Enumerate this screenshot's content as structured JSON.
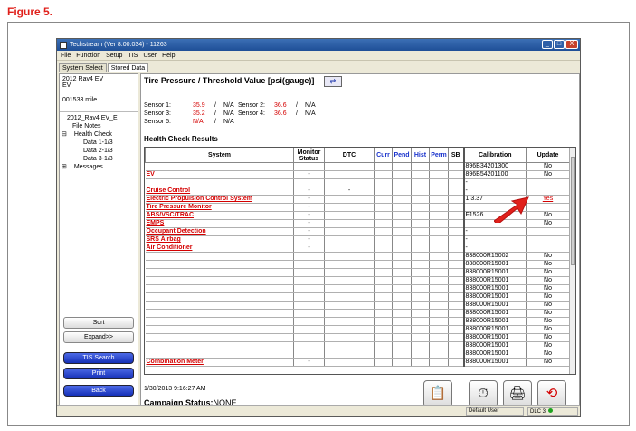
{
  "figure_label": "Figure 5.",
  "window": {
    "title": "Techstream (Ver 8.00.034) - 11263",
    "controls": [
      "_",
      "□",
      "X"
    ]
  },
  "menu": [
    "File",
    "Function",
    "Setup",
    "TIS",
    "User",
    "Help"
  ],
  "tabs": [
    "System Select",
    "Stored Data"
  ],
  "left_panel": {
    "vehicle": "2012 Rav4 EV",
    "vehicle_sub": "EV",
    "mileage": "001533 mile",
    "tree": [
      {
        "label": "2012_Rav4 EV_E",
        "prefix": ""
      },
      {
        "label": "File Notes",
        "prefix": ""
      },
      {
        "label": "Health Check",
        "prefix": "⊟"
      },
      {
        "label": "Data 1-1/3",
        "prefix": ""
      },
      {
        "label": "Data 2-1/3",
        "prefix": ""
      },
      {
        "label": "Data 3-1/3",
        "prefix": ""
      },
      {
        "label": "Messages",
        "prefix": "⊞"
      }
    ],
    "sort_label": "Sort",
    "expand_label": "Expand>>",
    "tis_search_label": "TIS Search",
    "print_label": "Print",
    "back_label": "Back"
  },
  "tire_pressure": {
    "title": "Tire Pressure / Threshold Value [psi(gauge)]",
    "sensors": [
      {
        "label": "Sensor 1:",
        "value": "35.9",
        "threshold": "N/A",
        "label2": "Sensor 2:",
        "value2": "36.6",
        "threshold2": "N/A"
      },
      {
        "label": "Sensor 3:",
        "value": "35.2",
        "threshold": "N/A",
        "label2": "Sensor 4:",
        "value2": "36.6",
        "threshold2": "N/A"
      },
      {
        "label": "Sensor 5:",
        "value": "N/A",
        "threshold": "N/A",
        "label2": "",
        "value2": "",
        "threshold2": ""
      }
    ]
  },
  "health_check": {
    "title": "Health Check Results",
    "columns": [
      "System",
      "Monitor Status",
      "DTC",
      "Curr",
      "Pend",
      "Hist",
      "Perm",
      "SB",
      "Calibration",
      "Update"
    ],
    "rows": [
      {
        "system": "",
        "monitor": "",
        "dtc": "",
        "calibration": "896B34201300",
        "update": "No"
      },
      {
        "system": "EV",
        "monitor": "-",
        "dtc": "",
        "calibration": "896B54201100",
        "update": "No"
      },
      {
        "system": "",
        "monitor": "",
        "dtc": "",
        "calibration": "-",
        "update": ""
      },
      {
        "system": "Cruise Control",
        "monitor": "-",
        "dtc": "-",
        "calibration": "-",
        "update": ""
      },
      {
        "system": "Electric Propulsion Control System",
        "monitor": "-",
        "dtc": "",
        "calibration": "1.3.37",
        "update": "Yes"
      },
      {
        "system": "Tire Pressure Monitor",
        "monitor": "-",
        "dtc": "",
        "calibration": "",
        "update": ""
      },
      {
        "system": "ABS/VSC/TRAC",
        "monitor": "-",
        "dtc": "",
        "calibration": "F1526",
        "update": "No"
      },
      {
        "system": "EMPS",
        "monitor": "-",
        "dtc": "",
        "calibration": "",
        "update": "No"
      },
      {
        "system": "Occupant Detection",
        "monitor": "-",
        "dtc": "",
        "calibration": "-",
        "update": ""
      },
      {
        "system": "SRS Airbag",
        "monitor": "-",
        "dtc": "",
        "calibration": "-",
        "update": ""
      },
      {
        "system": "Air Conditioner",
        "monitor": "-",
        "dtc": "",
        "calibration": "-",
        "update": ""
      },
      {
        "system": "",
        "monitor": "",
        "dtc": "",
        "calibration": "838000R15002",
        "update": "No"
      },
      {
        "system": "",
        "monitor": "",
        "dtc": "",
        "calibration": "838000R15001",
        "update": "No"
      },
      {
        "system": "",
        "monitor": "",
        "dtc": "",
        "calibration": "838000R15001",
        "update": "No"
      },
      {
        "system": "",
        "monitor": "",
        "dtc": "",
        "calibration": "838000R15001",
        "update": "No"
      },
      {
        "system": "",
        "monitor": "",
        "dtc": "",
        "calibration": "838000R15001",
        "update": "No"
      },
      {
        "system": "",
        "monitor": "",
        "dtc": "",
        "calibration": "838000R15001",
        "update": "No"
      },
      {
        "system": "",
        "monitor": "",
        "dtc": "",
        "calibration": "838000R15001",
        "update": "No"
      },
      {
        "system": "",
        "monitor": "",
        "dtc": "",
        "calibration": "838000R15001",
        "update": "No"
      },
      {
        "system": "",
        "monitor": "",
        "dtc": "",
        "calibration": "838000R15001",
        "update": "No"
      },
      {
        "system": "",
        "monitor": "",
        "dtc": "",
        "calibration": "838000R15001",
        "update": "No"
      },
      {
        "system": "",
        "monitor": "",
        "dtc": "",
        "calibration": "838000R15001",
        "update": "No"
      },
      {
        "system": "",
        "monitor": "",
        "dtc": "",
        "calibration": "838000R15001",
        "update": "No"
      },
      {
        "system": "",
        "monitor": "",
        "dtc": "",
        "calibration": "838000R15001",
        "update": "No"
      },
      {
        "system": "Combination Meter",
        "monitor": "-",
        "dtc": "",
        "calibration": "838000R15001",
        "update": "No"
      }
    ]
  },
  "bottom": {
    "datetime": "1/30/2013 9:16:27 AM",
    "campaign_label": "Campaign Status:",
    "campaign_value": "NONE"
  },
  "statusbar": {
    "user": "Default User",
    "dlc": "DLC 3"
  },
  "icons": [
    "report-icon",
    "dtc-gauge-icon",
    "print-edit-icon",
    "refresh-icon"
  ],
  "colors": {
    "accent_red": "#d40000",
    "link_blue": "#1a33cc",
    "button_blue": "#1530b8"
  }
}
